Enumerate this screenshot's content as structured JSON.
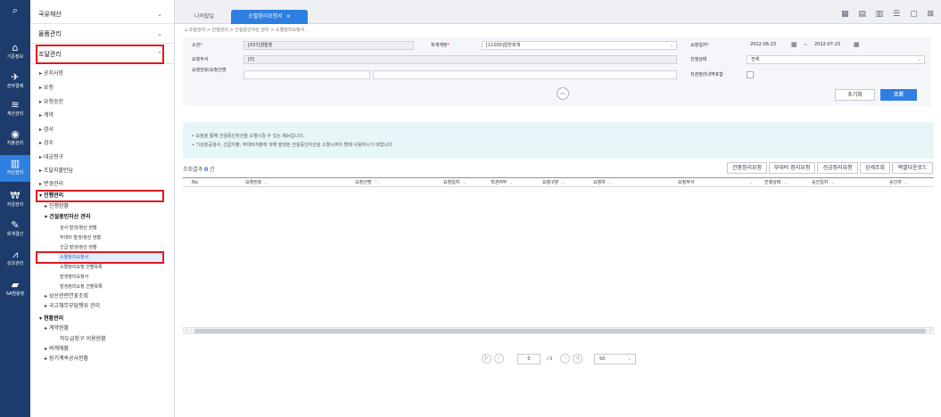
{
  "rail": [
    {
      "icon": "search-icon",
      "label": ""
    },
    {
      "icon": "home-icon",
      "label": "기준정보"
    },
    {
      "icon": "plane-icon",
      "label": "전자결재"
    },
    {
      "icon": "coins-icon",
      "label": "계산관리"
    },
    {
      "icon": "wallet-icon",
      "label": "지출관리"
    },
    {
      "icon": "building-icon",
      "label": "자산관리"
    },
    {
      "icon": "money-icon",
      "label": "자금관리"
    },
    {
      "icon": "edit-icon",
      "label": "회계결산"
    },
    {
      "icon": "chart-icon",
      "label": "성과관리"
    },
    {
      "icon": "folder-icon",
      "label": "SA범용정"
    }
  ],
  "menu": {
    "groups": [
      {
        "label": "국유재산"
      },
      {
        "label": "물품관리"
      },
      {
        "label": "조달관리"
      }
    ],
    "items": [
      "▸ 공지사항",
      "▸ 요청",
      "▸ 요청승인",
      "▸ 계약",
      "▸ 검사",
      "▸ 검수",
      "▸ 대금청구",
      "▸ 조달지출반납",
      "▸ 변경관리",
      "▾ 진행관리",
      "▸ 진행현황",
      "▾ 건설중인자산 관리",
      "검사 발생/정산 현황",
      "부대비 발생/정산 현황",
      "선급 발생/정산 현황",
      "소멸정리요청서",
      "소멸정리요청 건별목록",
      "발생정리요청서",
      "발생정리요청 건별목록",
      "▸ 성산관련연표조회",
      "▸ 국고채무부담행위 관리",
      "▾ 현황관리",
      "▸ 계약현황",
      "하도급청구 이용현황",
      "▸ 여계해황",
      "▸ 장기계속공사현황"
    ]
  },
  "tabs": {
    "tab1": "나의할일",
    "tab2": "소멸정리요청서",
    "close": "×",
    "icons": "▦ ▤ ▥ ☰ ▢ ⊠"
  },
  "breadcrumb": "⌂ 조달관리 > 진행관리 > 건설중인자산 관리 > 소멸정리요청서",
  "form": {
    "f1_label": "소관",
    "f1_value": "[037]경찰청",
    "f2_label": "회계계정",
    "f2_value": "[11000]일반회계",
    "f3_label": "요청일자",
    "date_from": "2022-06-23",
    "date_sep": "~",
    "date_to": "2022-07-23",
    "f4_label": "요청부서",
    "f4_value": "[0]",
    "f5_label": "진행상태",
    "f5_value": "전체",
    "f6_label": "요청번호/요청건명",
    "f6_value": "",
    "f7_label": "직권정리내역포함",
    "collapse": "︿",
    "reset": "초기화",
    "search": "조회"
  },
  "info": {
    "line1": "• 요청을 통해 건설중인자산을 소멸시킬 수 있는 메뉴입니다.",
    "line2": "• 기성분공검사, 선급지출, 부대비지출에 의해 발생된 건설중인자산을 소멸시켜야 할때 사용하시기 바랍니다."
  },
  "result": {
    "label": "조회결과",
    "count": "0",
    "unit": "건"
  },
  "table_buttons": [
    "건중정리요청",
    "부대비 정리요청",
    "선금정리요청",
    "상세조회",
    "엑셀다운로드"
  ],
  "columns": [
    "No.",
    "요청번호",
    "요청건명",
    "요청일자",
    "직권여부",
    "요청구분",
    "요청자",
    "요청부서",
    "진행상태",
    "승인일자",
    "승인자"
  ],
  "scroll": {
    "left": "‹",
    "right": "›"
  },
  "pager": {
    "first": "|‹",
    "prev": "‹",
    "page": "0",
    "sep": "/",
    "total": "0",
    "next": "›",
    "last": "›|",
    "size": "50"
  }
}
